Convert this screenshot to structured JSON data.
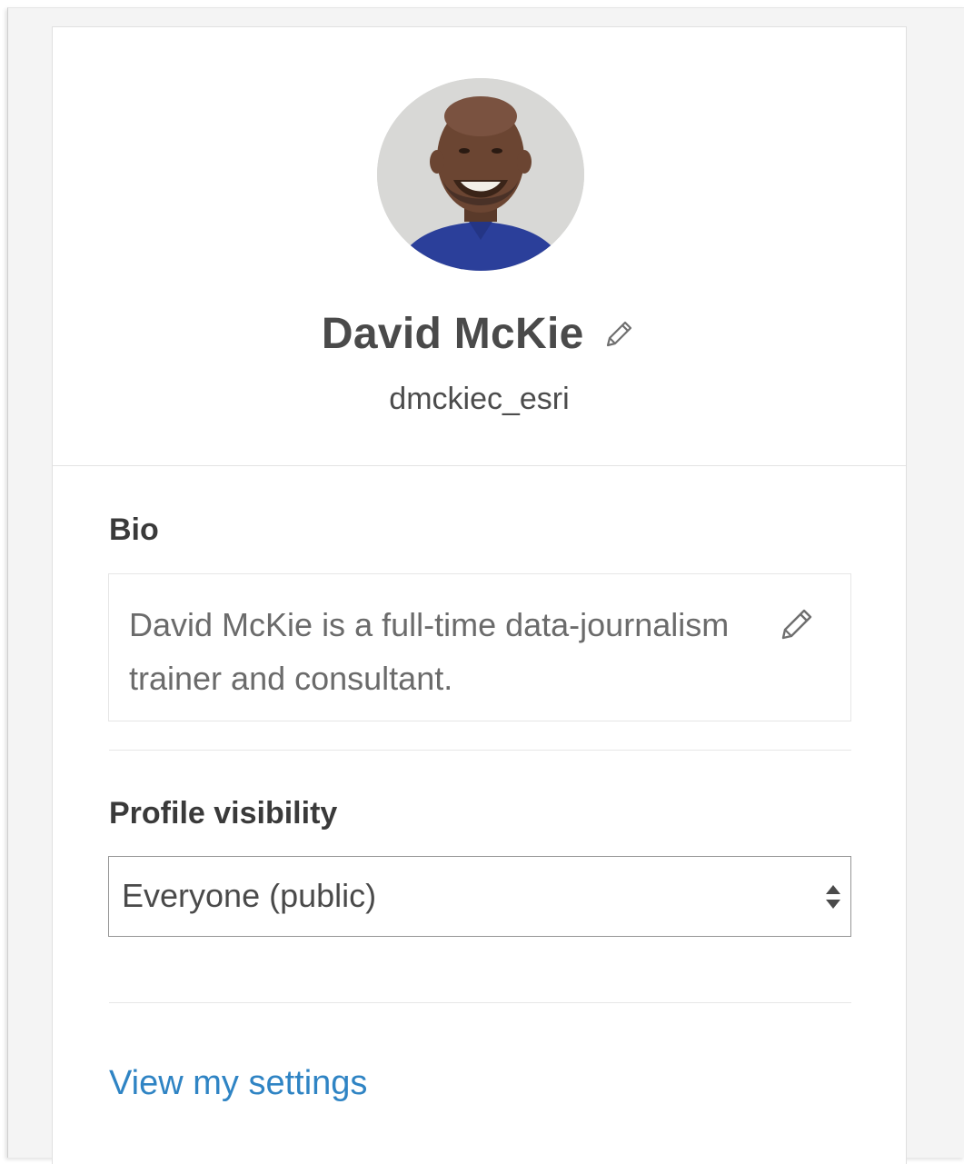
{
  "profile": {
    "name": "David McKie",
    "username": "dmckiec_esri",
    "name_edit_icon": "pencil-icon",
    "avatar": "avatar-photo"
  },
  "bio": {
    "label": "Bio",
    "text": "David McKie is a full-time data-journalism trainer and consultant.",
    "edit_icon": "pencil-icon"
  },
  "visibility": {
    "label": "Profile visibility",
    "selected": "Everyone (public)",
    "arrow_icon": "select-arrows-icon"
  },
  "settings_link": {
    "label": "View my settings",
    "color": "#2f84c4"
  },
  "colors": {
    "text_primary": "#4a4a4a",
    "text_muted": "#6b6b6b",
    "link": "#2f84c4",
    "border": "#e6e6e6"
  }
}
